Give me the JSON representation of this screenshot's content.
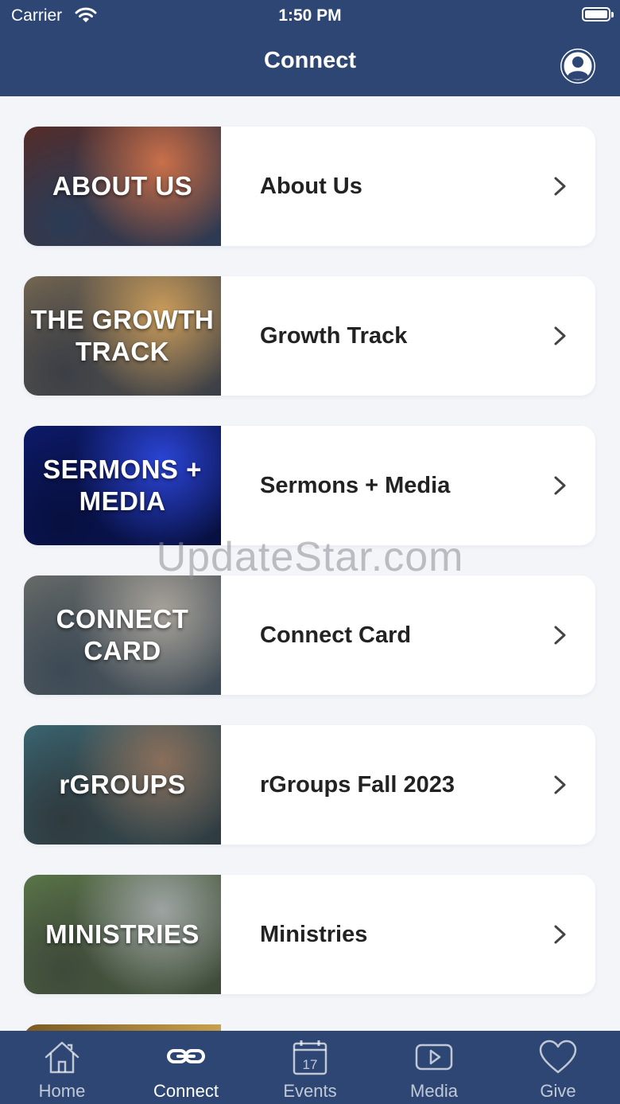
{
  "status_bar": {
    "carrier": "Carrier",
    "time": "1:50 PM"
  },
  "header": {
    "title": "Connect"
  },
  "items": [
    {
      "label": "About Us",
      "thumb_text": "ABOUT US",
      "colors": [
        "#5b2a22",
        "#c9704a",
        "#2b3b55"
      ]
    },
    {
      "label": "Growth Track",
      "thumb_text": "THE GROWTH TRACK",
      "colors": [
        "#7a6a52",
        "#c99b5a",
        "#3b3f46"
      ]
    },
    {
      "label": "Sermons + Media",
      "thumb_text": "SERMONS + MEDIA",
      "colors": [
        "#0d1b6e",
        "#2b45d6",
        "#081040"
      ]
    },
    {
      "label": "Connect Card",
      "thumb_text": "CONNECT CARD",
      "colors": [
        "#6c6e6a",
        "#a7a29a",
        "#3d4a55"
      ]
    },
    {
      "label": "rGroups Fall 2023",
      "thumb_text": "rGROUPS",
      "colors": [
        "#3b6a77",
        "#8a6e5a",
        "#2f3a3e"
      ]
    },
    {
      "label": "Ministries",
      "thumb_text": "MINISTRIES",
      "colors": [
        "#5d7a4a",
        "#9ea3a3",
        "#3e4a3a"
      ]
    }
  ],
  "watermark": "UpdateStar.com",
  "tabs": [
    {
      "label": "Home",
      "icon": "home-icon",
      "active": false
    },
    {
      "label": "Connect",
      "icon": "link-icon",
      "active": true
    },
    {
      "label": "Events",
      "icon": "calendar-icon",
      "active": false,
      "badge": "17"
    },
    {
      "label": "Media",
      "icon": "play-icon",
      "active": false
    },
    {
      "label": "Give",
      "icon": "heart-icon",
      "active": false
    }
  ],
  "colors": {
    "nav": "#2e4674",
    "background": "#f3f5f9"
  }
}
